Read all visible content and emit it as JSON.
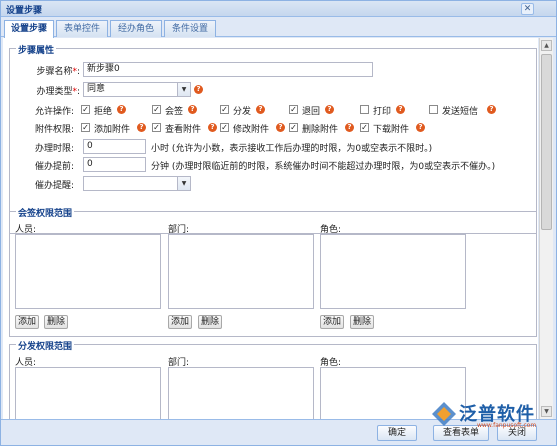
{
  "window": {
    "title": "设置步骤",
    "close": "✕"
  },
  "tabs": [
    "设置步骤",
    "表单控件",
    "经办角色",
    "条件设置"
  ],
  "step_props": {
    "legend": "步骤属性",
    "name_label": "步骤名称",
    "name_value": "新步骤0",
    "type_label": "办理类型",
    "type_value": "同意",
    "allow_label": "允许操作:",
    "allow_items": [
      {
        "label": "拒绝",
        "checked": true
      },
      {
        "label": "会签",
        "checked": true
      },
      {
        "label": "分发",
        "checked": true
      },
      {
        "label": "退回",
        "checked": true
      },
      {
        "label": "打印",
        "checked": false
      },
      {
        "label": "发送短信",
        "checked": false
      }
    ],
    "attach_label": "附件权限:",
    "attach_items": [
      {
        "label": "添加附件",
        "checked": true
      },
      {
        "label": "查看附件",
        "checked": true
      },
      {
        "label": "修改附件",
        "checked": true
      },
      {
        "label": "删除附件",
        "checked": true
      },
      {
        "label": "下载附件",
        "checked": true
      }
    ],
    "time_limit_label": "办理时限:",
    "time_limit_value": "0",
    "time_limit_note": "小时 (允许为小数，表示接收工作后办理的时限，为0或空表示不限时。)",
    "urge_label": "催办提前:",
    "urge_value": "0",
    "urge_note": "分钟 (办理时限临近前的时限，系统催办时间不能超过办理时限，为0或空表示不催办。)",
    "remind_label": "催办提醒:",
    "remind_value": ""
  },
  "countersign": {
    "legend": "会签权限范围",
    "person_label": "人员:",
    "dept_label": "部门:",
    "role_label": "角色:",
    "add": "添加",
    "delete": "删除"
  },
  "distribute": {
    "legend": "分发权限范围",
    "person_label": "人员:",
    "dept_label": "部门:",
    "role_label": "角色:"
  },
  "footer": {
    "ok": "确定",
    "view_form": "查看表单",
    "close": "关闭"
  },
  "logo": {
    "name": "泛普软件",
    "url": "www.fanpusoft.com"
  },
  "colors": {
    "accent": "#15428b",
    "help": "#e05a1f",
    "border": "#99bbe8"
  }
}
